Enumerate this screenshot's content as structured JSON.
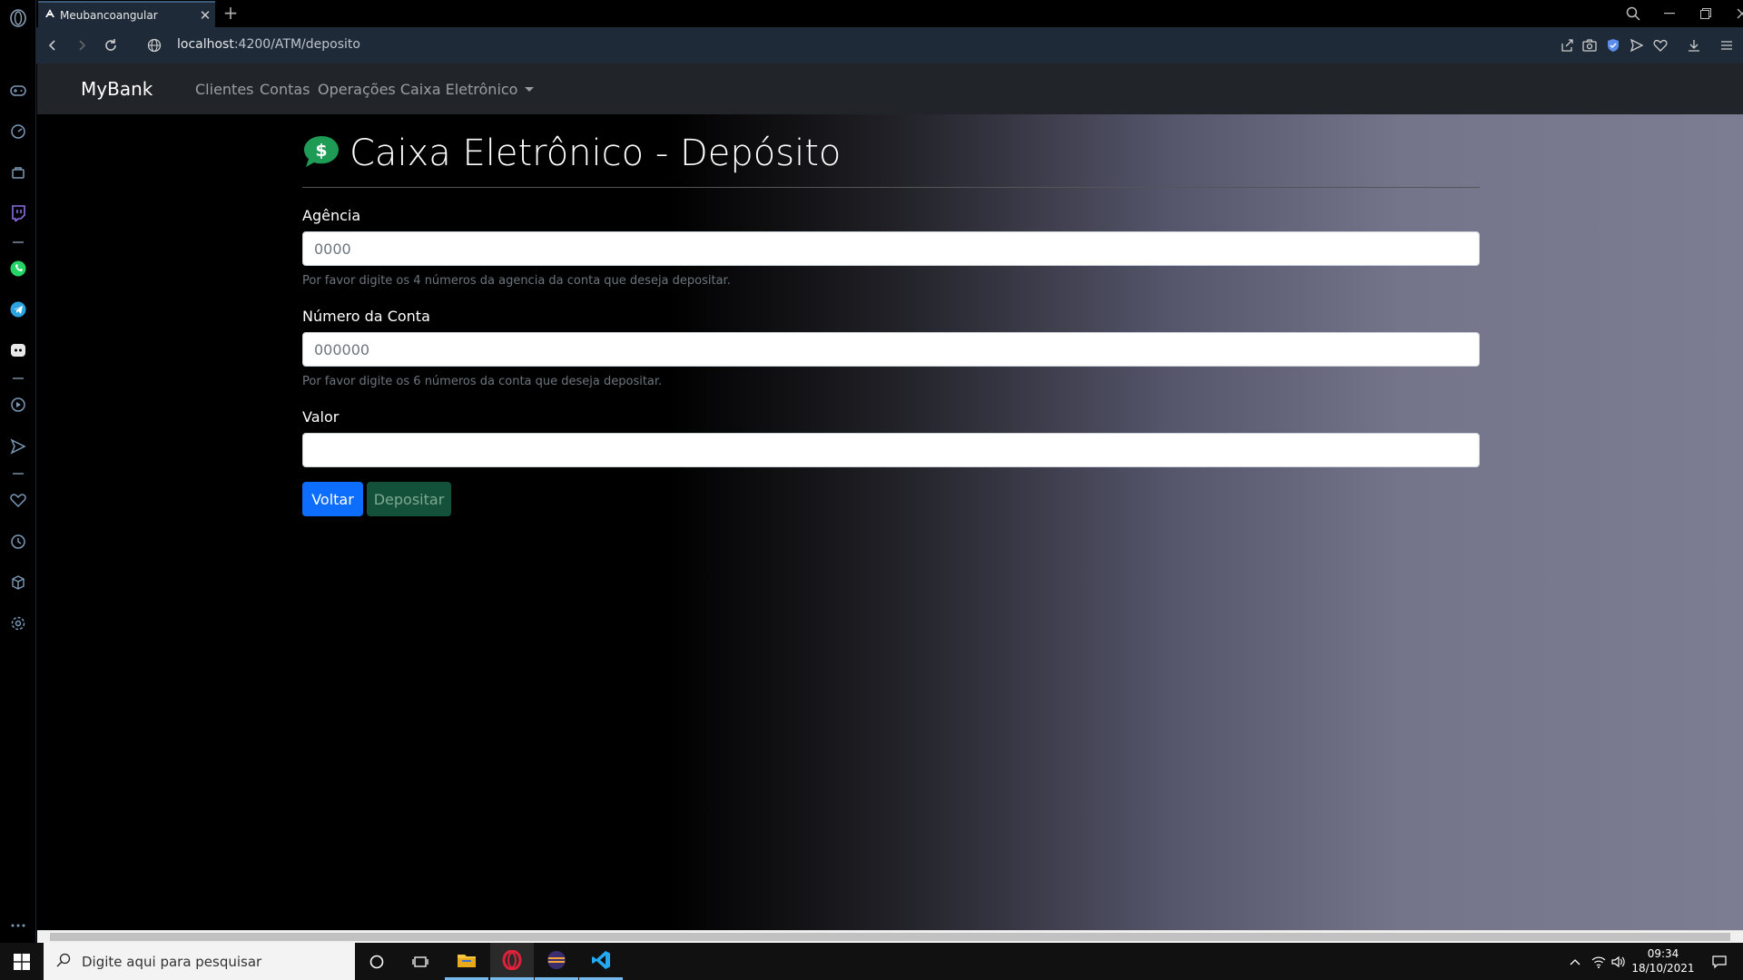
{
  "browser": {
    "tab_title": "Meubancoangular",
    "url_host": "localhost",
    "url_path": ":4200/ATM/deposito"
  },
  "navbar": {
    "brand": "MyBank",
    "links": [
      "Clientes",
      "Contas",
      "Operações Caixa Eletrônico"
    ]
  },
  "form": {
    "title": "Caixa Eletrônico - Depósito",
    "agencia": {
      "label": "Agência",
      "placeholder": "0000",
      "help": "Por favor digite os 4 números da agencia da conta que deseja depositar."
    },
    "conta": {
      "label": "Número da Conta",
      "placeholder": "000000",
      "help": "Por favor digite os 6 números da conta que deseja depositar."
    },
    "valor": {
      "label": "Valor",
      "value": ""
    },
    "buttons": {
      "back": "Voltar",
      "deposit": "Depositar"
    }
  },
  "taskbar": {
    "search_placeholder": "Digite aqui para pesquisar",
    "time": "09:34",
    "date": "18/10/2021"
  },
  "colors": {
    "accent_primary": "#0d6efd",
    "deposit_button": "#13513a",
    "icon_green": "#1e9b55",
    "navbar_bg": "#212529"
  }
}
